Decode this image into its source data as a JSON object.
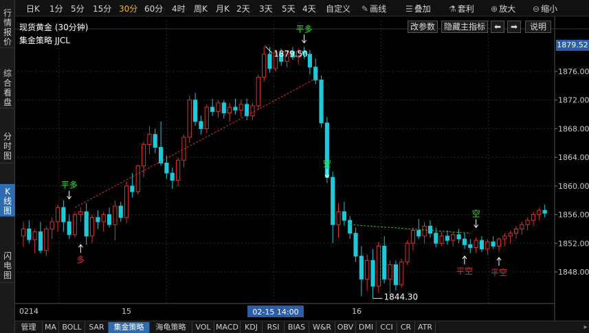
{
  "left_tabs": [
    {
      "label": "行情报价"
    },
    {
      "label": "综合看盘"
    },
    {
      "label": "分时图"
    },
    {
      "label": "K线图",
      "active": true
    },
    {
      "label": "闪电图"
    }
  ],
  "periods": [
    {
      "label": "日K"
    },
    {
      "label": "1分"
    },
    {
      "label": "5分"
    },
    {
      "label": "15分"
    },
    {
      "label": "30分",
      "active": true
    },
    {
      "label": "60分"
    },
    {
      "label": "4时"
    },
    {
      "label": "周K"
    },
    {
      "label": "月K"
    },
    {
      "label": "2天"
    },
    {
      "label": "3天"
    },
    {
      "label": "5天"
    },
    {
      "label": "4天"
    },
    {
      "label": "自定义"
    }
  ],
  "tools": [
    {
      "label": "画线",
      "icon": "pencil-icon"
    },
    {
      "label": "叠加",
      "icon": "layers-icon"
    },
    {
      "label": "套利",
      "icon": "flask-icon"
    },
    {
      "label": "放大",
      "icon": "zoom-in-icon"
    },
    {
      "label": "缩小",
      "icon": "zoom-out-icon"
    }
  ],
  "chart_header": {
    "title": "现货黄金 (30分钟)",
    "strategy": "集金策略 JJCL",
    "buttons": {
      "change_params": "改参数",
      "hide_main": "隐藏主指标",
      "prev": "⬅",
      "next": "➡",
      "help": "说明"
    }
  },
  "price_axis": {
    "ticks": [
      "1876.00",
      "1872.00",
      "1868.00",
      "1864.00",
      "1860.00",
      "1856.00",
      "1852.00",
      "1848.00"
    ],
    "current_price": "1879.52"
  },
  "time_axis": {
    "labels": [
      "0214",
      "15",
      "16"
    ],
    "cursor_label": "02-15 14:00"
  },
  "annotations": {
    "high_value": "1879.50",
    "low_value": "1844.30",
    "ping_duo": "平多",
    "duo": "多",
    "kong": "空",
    "ping_kong": "平空"
  },
  "chart_data": {
    "type": "candlestick",
    "y_ticks": [
      1848,
      1852,
      1856,
      1860,
      1864,
      1868,
      1872,
      1876
    ],
    "candles": [
      {
        "o": 1853.0,
        "h": 1855.0,
        "l": 1851.5,
        "c": 1854.0
      },
      {
        "o": 1854.0,
        "h": 1855.2,
        "l": 1852.0,
        "c": 1852.5
      },
      {
        "o": 1852.5,
        "h": 1854.0,
        "l": 1850.6,
        "c": 1853.6
      },
      {
        "o": 1853.6,
        "h": 1855.0,
        "l": 1850.6,
        "c": 1851.0
      },
      {
        "o": 1851.0,
        "h": 1854.4,
        "l": 1850.2,
        "c": 1854.0
      },
      {
        "o": 1854.0,
        "h": 1855.6,
        "l": 1852.6,
        "c": 1855.0
      },
      {
        "o": 1855.0,
        "h": 1857.4,
        "l": 1853.6,
        "c": 1857.0
      },
      {
        "o": 1857.0,
        "h": 1858.0,
        "l": 1853.6,
        "c": 1855.0
      },
      {
        "o": 1855.0,
        "h": 1856.0,
        "l": 1852.6,
        "c": 1853.2
      },
      {
        "o": 1853.2,
        "h": 1856.4,
        "l": 1852.8,
        "c": 1856.0
      },
      {
        "o": 1856.0,
        "h": 1857.0,
        "l": 1855.0,
        "c": 1856.4
      },
      {
        "o": 1856.4,
        "h": 1857.6,
        "l": 1851.8,
        "c": 1853.0
      },
      {
        "o": 1853.0,
        "h": 1856.0,
        "l": 1852.0,
        "c": 1855.6
      },
      {
        "o": 1855.6,
        "h": 1856.6,
        "l": 1854.0,
        "c": 1855.0
      },
      {
        "o": 1855.0,
        "h": 1856.4,
        "l": 1853.6,
        "c": 1856.0
      },
      {
        "o": 1856.0,
        "h": 1857.0,
        "l": 1854.2,
        "c": 1854.6
      },
      {
        "o": 1854.6,
        "h": 1858.0,
        "l": 1852.4,
        "c": 1857.2
      },
      {
        "o": 1857.2,
        "h": 1857.8,
        "l": 1855.0,
        "c": 1855.6
      },
      {
        "o": 1855.6,
        "h": 1860.6,
        "l": 1854.8,
        "c": 1860.0
      },
      {
        "o": 1860.0,
        "h": 1861.8,
        "l": 1858.4,
        "c": 1859.2
      },
      {
        "o": 1859.2,
        "h": 1863.0,
        "l": 1858.8,
        "c": 1862.8
      },
      {
        "o": 1862.8,
        "h": 1866.2,
        "l": 1861.2,
        "c": 1865.8
      },
      {
        "o": 1865.8,
        "h": 1868.4,
        "l": 1864.4,
        "c": 1867.2
      },
      {
        "o": 1867.2,
        "h": 1868.0,
        "l": 1864.6,
        "c": 1865.4
      },
      {
        "o": 1865.4,
        "h": 1869.0,
        "l": 1862.8,
        "c": 1863.2
      },
      {
        "o": 1863.2,
        "h": 1864.2,
        "l": 1861.0,
        "c": 1861.8
      },
      {
        "o": 1861.8,
        "h": 1862.6,
        "l": 1859.6,
        "c": 1860.8
      },
      {
        "o": 1860.8,
        "h": 1864.0,
        "l": 1860.0,
        "c": 1863.6
      },
      {
        "o": 1863.6,
        "h": 1867.2,
        "l": 1862.6,
        "c": 1866.8
      },
      {
        "o": 1866.8,
        "h": 1872.6,
        "l": 1866.0,
        "c": 1872.0
      },
      {
        "o": 1872.0,
        "h": 1873.0,
        "l": 1868.4,
        "c": 1869.0
      },
      {
        "o": 1869.0,
        "h": 1869.8,
        "l": 1867.2,
        "c": 1868.0
      },
      {
        "o": 1868.0,
        "h": 1871.4,
        "l": 1867.4,
        "c": 1871.0
      },
      {
        "o": 1871.0,
        "h": 1872.2,
        "l": 1869.8,
        "c": 1870.4
      },
      {
        "o": 1870.4,
        "h": 1872.0,
        "l": 1869.6,
        "c": 1871.6
      },
      {
        "o": 1871.6,
        "h": 1872.0,
        "l": 1869.4,
        "c": 1870.2
      },
      {
        "o": 1870.2,
        "h": 1871.6,
        "l": 1869.0,
        "c": 1871.0
      },
      {
        "o": 1871.0,
        "h": 1872.2,
        "l": 1870.0,
        "c": 1870.6
      },
      {
        "o": 1870.6,
        "h": 1872.0,
        "l": 1869.6,
        "c": 1871.4
      },
      {
        "o": 1871.4,
        "h": 1872.2,
        "l": 1869.2,
        "c": 1869.8
      },
      {
        "o": 1869.8,
        "h": 1871.6,
        "l": 1869.2,
        "c": 1871.2
      },
      {
        "o": 1871.2,
        "h": 1875.6,
        "l": 1870.6,
        "c": 1875.2
      },
      {
        "o": 1875.2,
        "h": 1879.5,
        "l": 1874.6,
        "c": 1878.4
      },
      {
        "o": 1878.4,
        "h": 1879.4,
        "l": 1875.8,
        "c": 1876.4
      },
      {
        "o": 1876.4,
        "h": 1879.0,
        "l": 1876.0,
        "c": 1878.6
      },
      {
        "o": 1878.6,
        "h": 1879.2,
        "l": 1876.8,
        "c": 1877.4
      },
      {
        "o": 1877.4,
        "h": 1879.0,
        "l": 1876.6,
        "c": 1878.8
      },
      {
        "o": 1878.8,
        "h": 1879.4,
        "l": 1877.6,
        "c": 1878.0
      },
      {
        "o": 1878.0,
        "h": 1879.2,
        "l": 1877.0,
        "c": 1878.8
      },
      {
        "o": 1878.8,
        "h": 1879.4,
        "l": 1877.8,
        "c": 1878.4
      },
      {
        "o": 1878.4,
        "h": 1879.0,
        "l": 1875.6,
        "c": 1876.6
      },
      {
        "o": 1876.6,
        "h": 1877.8,
        "l": 1874.2,
        "c": 1874.8
      },
      {
        "o": 1874.8,
        "h": 1875.4,
        "l": 1868.2,
        "c": 1868.8
      },
      {
        "o": 1868.8,
        "h": 1869.6,
        "l": 1860.4,
        "c": 1861.2
      },
      {
        "o": 1861.2,
        "h": 1862.0,
        "l": 1852.0,
        "c": 1854.6
      },
      {
        "o": 1854.6,
        "h": 1857.6,
        "l": 1852.8,
        "c": 1856.4
      },
      {
        "o": 1856.4,
        "h": 1857.8,
        "l": 1854.4,
        "c": 1855.2
      },
      {
        "o": 1855.2,
        "h": 1855.8,
        "l": 1852.6,
        "c": 1853.4
      },
      {
        "o": 1853.4,
        "h": 1854.2,
        "l": 1849.4,
        "c": 1850.2
      },
      {
        "o": 1850.2,
        "h": 1851.6,
        "l": 1844.6,
        "c": 1847.0
      },
      {
        "o": 1847.0,
        "h": 1850.4,
        "l": 1845.4,
        "c": 1849.6
      },
      {
        "o": 1849.6,
        "h": 1851.2,
        "l": 1844.3,
        "c": 1846.0
      },
      {
        "o": 1846.0,
        "h": 1852.2,
        "l": 1845.0,
        "c": 1851.6
      },
      {
        "o": 1851.6,
        "h": 1853.0,
        "l": 1846.4,
        "c": 1847.0
      },
      {
        "o": 1847.0,
        "h": 1849.6,
        "l": 1845.0,
        "c": 1849.0
      },
      {
        "o": 1849.0,
        "h": 1849.6,
        "l": 1845.4,
        "c": 1846.2
      },
      {
        "o": 1846.2,
        "h": 1849.8,
        "l": 1845.8,
        "c": 1849.4
      },
      {
        "o": 1849.4,
        "h": 1852.4,
        "l": 1849.0,
        "c": 1852.0
      },
      {
        "o": 1852.0,
        "h": 1854.2,
        "l": 1851.0,
        "c": 1853.8
      },
      {
        "o": 1853.8,
        "h": 1855.4,
        "l": 1852.6,
        "c": 1853.0
      },
      {
        "o": 1853.0,
        "h": 1855.0,
        "l": 1852.0,
        "c": 1854.4
      },
      {
        "o": 1854.4,
        "h": 1855.2,
        "l": 1852.8,
        "c": 1853.4
      },
      {
        "o": 1853.4,
        "h": 1854.2,
        "l": 1851.4,
        "c": 1852.0
      },
      {
        "o": 1852.0,
        "h": 1853.6,
        "l": 1851.6,
        "c": 1853.0
      },
      {
        "o": 1853.0,
        "h": 1853.8,
        "l": 1851.8,
        "c": 1852.4
      },
      {
        "o": 1852.4,
        "h": 1853.6,
        "l": 1851.6,
        "c": 1853.2
      },
      {
        "o": 1853.2,
        "h": 1854.0,
        "l": 1852.0,
        "c": 1852.6
      },
      {
        "o": 1852.6,
        "h": 1853.4,
        "l": 1851.2,
        "c": 1851.8
      },
      {
        "o": 1851.8,
        "h": 1852.6,
        "l": 1850.6,
        "c": 1851.4
      },
      {
        "o": 1851.4,
        "h": 1852.8,
        "l": 1850.6,
        "c": 1852.4
      },
      {
        "o": 1852.4,
        "h": 1853.0,
        "l": 1850.8,
        "c": 1851.2
      },
      {
        "o": 1851.2,
        "h": 1852.6,
        "l": 1850.4,
        "c": 1852.2
      },
      {
        "o": 1852.2,
        "h": 1853.0,
        "l": 1851.2,
        "c": 1851.6
      },
      {
        "o": 1851.6,
        "h": 1852.8,
        "l": 1850.8,
        "c": 1852.6
      },
      {
        "o": 1852.6,
        "h": 1853.4,
        "l": 1851.6,
        "c": 1853.0
      },
      {
        "o": 1853.0,
        "h": 1853.8,
        "l": 1852.0,
        "c": 1853.4
      },
      {
        "o": 1853.4,
        "h": 1854.4,
        "l": 1852.6,
        "c": 1854.0
      },
      {
        "o": 1854.0,
        "h": 1855.0,
        "l": 1853.2,
        "c": 1854.6
      },
      {
        "o": 1854.6,
        "h": 1855.6,
        "l": 1853.8,
        "c": 1855.2
      },
      {
        "o": 1855.2,
        "h": 1856.4,
        "l": 1854.4,
        "c": 1856.0
      },
      {
        "o": 1856.0,
        "h": 1857.0,
        "l": 1855.2,
        "c": 1856.6
      },
      {
        "o": 1856.6,
        "h": 1857.4,
        "l": 1855.6,
        "c": 1856.2
      }
    ],
    "trend_lines": [
      {
        "color": "#e03030",
        "from": [
          9,
          1857.0
        ],
        "to": [
          51,
          1875.0
        ]
      },
      {
        "color": "#30c030",
        "from": [
          57,
          1854.6
        ],
        "to": [
          78,
          1853.4
        ]
      }
    ],
    "signals": [
      {
        "idx": 8,
        "price": 1858.0,
        "label_key": "ping_duo",
        "color": "#30e030",
        "side": "above"
      },
      {
        "idx": 10,
        "price": 1852.0,
        "label_key": "duo",
        "color": "#e03030",
        "side": "below"
      },
      {
        "idx": 53,
        "price": 1861.0,
        "label_key": "kong",
        "color": "#30e030",
        "side": "above"
      },
      {
        "idx": 49,
        "price": 1879.8,
        "label_key": "ping_duo",
        "color": "#30e030",
        "side": "above"
      },
      {
        "idx": 79,
        "price": 1854.0,
        "label_key": "kong",
        "color": "#30e030",
        "side": "above"
      },
      {
        "idx": 77,
        "price": 1850.4,
        "label_key": "ping_kong",
        "color": "#e03030",
        "side": "below"
      },
      {
        "idx": 83,
        "price": 1850.2,
        "label_key": "ping_kong",
        "color": "#e03030",
        "side": "below"
      }
    ]
  },
  "bottom_tabs": [
    {
      "label": "管理"
    },
    {
      "label": "MA"
    },
    {
      "label": "BOLL"
    },
    {
      "label": "SAR"
    },
    {
      "label": "集金策略",
      "active": true
    },
    {
      "label": "海龟策略"
    },
    {
      "label": "VOL"
    },
    {
      "label": "MACD"
    },
    {
      "label": "KDJ"
    },
    {
      "label": "RSI"
    },
    {
      "label": "BIAS"
    },
    {
      "label": "W&R"
    },
    {
      "label": "OBV"
    },
    {
      "label": "DMI"
    },
    {
      "label": "CCI"
    },
    {
      "label": "CR"
    },
    {
      "label": "ATR"
    }
  ],
  "colors": {
    "up": "#e0342c",
    "down": "#1ec8d8",
    "accent": "#2f6bb3"
  }
}
